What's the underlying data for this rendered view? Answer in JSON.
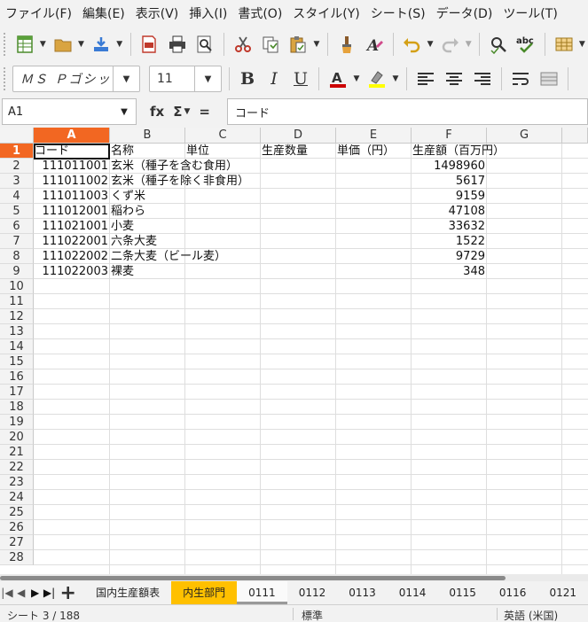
{
  "menu": [
    "ファイル(F)",
    "編集(E)",
    "表示(V)",
    "挿入(I)",
    "書式(O)",
    "スタイル(Y)",
    "シート(S)",
    "データ(D)",
    "ツール(T)"
  ],
  "toolbar2": {
    "font_name": "ＭＳ Ｐゴシック",
    "font_size": "11",
    "bold_label": "B",
    "italic_label": "I",
    "underline_label": "U"
  },
  "colors": {
    "font_color": "#cc0000",
    "highlight_color": "#ffff00",
    "selection": "#f26722",
    "active_tab": "#ffc000"
  },
  "formula_bar": {
    "cell_ref": "A1",
    "fx_label": "fx",
    "sigma_label": "Σ",
    "equals_label": "=",
    "content": "コード"
  },
  "grid": {
    "columns": [
      "A",
      "B",
      "C",
      "D",
      "E",
      "F",
      "G"
    ],
    "selected_column": "A",
    "rows": [
      "1",
      "2",
      "3",
      "4",
      "5",
      "6",
      "7",
      "8",
      "9",
      "10",
      "11",
      "12",
      "13",
      "14",
      "15",
      "16",
      "17",
      "18",
      "19",
      "20",
      "21",
      "22",
      "23",
      "24",
      "25",
      "26",
      "27",
      "28"
    ],
    "selected_row": "1",
    "header": {
      "A": "コード",
      "B": "名称",
      "C": "単位",
      "D": "生産数量",
      "E": "単価（円）",
      "F": "生産額（百万円）"
    },
    "data": [
      {
        "code": "111011001",
        "name": "玄米（種子を含む食用）",
        "value": "1498960"
      },
      {
        "code": "111011002",
        "name": "玄米（種子を除く非食用）",
        "value": "5617"
      },
      {
        "code": "111011003",
        "name": "くず米",
        "value": "9159"
      },
      {
        "code": "111012001",
        "name": "稲わら",
        "value": "47108"
      },
      {
        "code": "111021001",
        "name": "小麦",
        "value": "33632"
      },
      {
        "code": "111022001",
        "name": "六条大麦",
        "value": "1522"
      },
      {
        "code": "111022002",
        "name": "二条大麦（ビール麦）",
        "value": "9729"
      },
      {
        "code": "111022003",
        "name": "裸麦",
        "value": "348"
      }
    ]
  },
  "tabs": [
    "国内生産額表",
    "内生部門",
    "0111",
    "0112",
    "0113",
    "0114",
    "0115",
    "0116",
    "0121"
  ],
  "active_tab": "内生部門",
  "status": {
    "sheet": "シート 3 / 188",
    "style": "標準",
    "language": "英語 (米国)"
  }
}
